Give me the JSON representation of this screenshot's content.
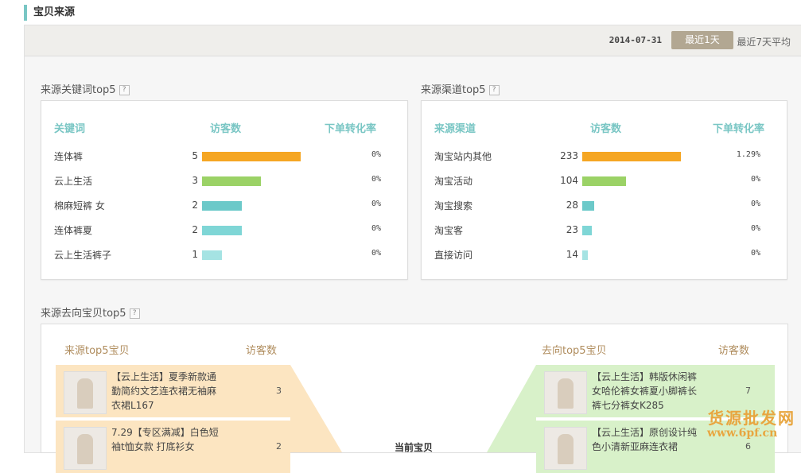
{
  "header": {
    "title": "宝贝来源"
  },
  "toolbar": {
    "date": "2014-07-31",
    "btn_1day": "最近1天",
    "btn_7day": "最近7天平均"
  },
  "keywords": {
    "title": "来源关键词top5",
    "help": "?",
    "col_name": "关键词",
    "col_visitors": "访客数",
    "col_rate": "下单转化率",
    "rows": [
      {
        "name": "连体裤",
        "visitors": "5",
        "share": 1.0,
        "color": "#f5a623",
        "rate": "0%"
      },
      {
        "name": "云上生活",
        "visitors": "3",
        "share": 0.6,
        "color": "#9bd266",
        "rate": "0%"
      },
      {
        "name": "棉麻短裤 女",
        "visitors": "2",
        "share": 0.4,
        "color": "#6cc9c9",
        "rate": "0%"
      },
      {
        "name": "连体裤夏",
        "visitors": "2",
        "share": 0.4,
        "color": "#7fd6d6",
        "rate": "0%"
      },
      {
        "name": "云上生活裤子",
        "visitors": "1",
        "share": 0.2,
        "color": "#a5e3e3",
        "rate": "0%"
      }
    ]
  },
  "channels": {
    "title": "来源渠道top5",
    "help": "?",
    "col_name": "来源渠道",
    "col_visitors": "访客数",
    "col_rate": "下单转化率",
    "rows": [
      {
        "name": "淘宝站内其他",
        "visitors": "233",
        "share": 1.0,
        "color": "#f5a623",
        "rate": "1.29%"
      },
      {
        "name": "淘宝活动",
        "visitors": "104",
        "share": 0.446,
        "color": "#9bd266",
        "rate": "0%"
      },
      {
        "name": "淘宝搜索",
        "visitors": "28",
        "share": 0.12,
        "color": "#6cc9c9",
        "rate": "0%"
      },
      {
        "name": "淘宝客",
        "visitors": "23",
        "share": 0.099,
        "color": "#7fd6d6",
        "rate": "0%"
      },
      {
        "name": "直接访问",
        "visitors": "14",
        "share": 0.06,
        "color": "#a5e3e3",
        "rate": "0%"
      }
    ]
  },
  "flow": {
    "title": "来源去向宝贝top5",
    "help": "?",
    "src_header": "来源top5宝贝",
    "src_visitors_header": "访客数",
    "dst_header": "去向top5宝贝",
    "dst_visitors_header": "访客数",
    "center": "当前宝贝",
    "sources": [
      {
        "text": "【云上生活】夏季新款通勤简约文艺连衣裙无袖麻衣裙L167",
        "visitors": "3"
      },
      {
        "text": "7.29【专区满减】白色短袖t恤女款 打底衫女",
        "visitors": "2"
      }
    ],
    "destinations": [
      {
        "text": "【云上生活】韩版休闲裤女哈伦裤女裤夏小脚裤长裤七分裤女K285",
        "visitors": "7"
      },
      {
        "text": "【云上生活】原创设计纯色小清新亚麻连衣裙",
        "visitors": "6"
      }
    ]
  },
  "watermark": {
    "line1": "货源批发网",
    "line2": "www.6pf.cn"
  }
}
